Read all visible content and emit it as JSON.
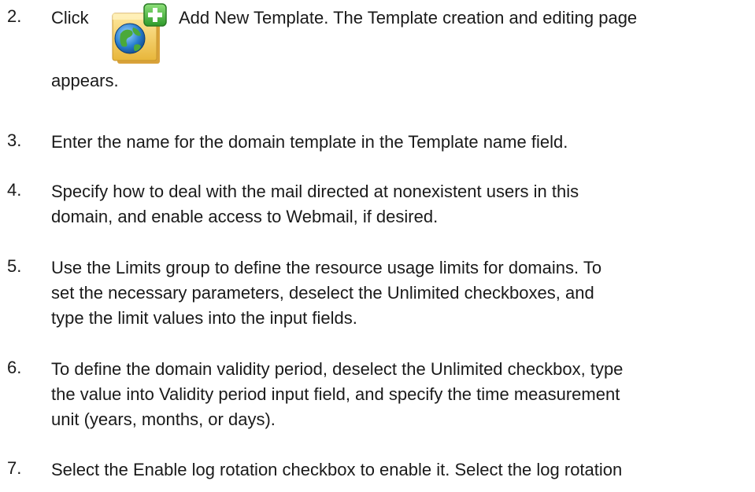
{
  "steps": [
    {
      "number": "2.",
      "lines": [
        "Click",
        "Add New Template. The Template creation and editing page",
        "appears."
      ]
    },
    {
      "number": "3.",
      "lines": [
        "Enter the name for the domain template in the Template name field."
      ]
    },
    {
      "number": "4.",
      "lines": [
        "Specify how to deal with the mail directed at nonexistent users in this",
        "domain, and enable access to Webmail, if desired."
      ]
    },
    {
      "number": "5.",
      "lines": [
        "Use the Limits group to define the resource usage limits for domains. To",
        "set the necessary parameters, deselect the Unlimited checkboxes, and",
        "type the limit values into the input fields."
      ]
    },
    {
      "number": "6.",
      "lines": [
        "To define the domain validity period, deselect the Unlimited checkbox, type",
        "the value into Validity period input field, and specify the time measurement",
        "unit (years, months, or days)."
      ]
    },
    {
      "number": "7.",
      "lines": [
        "Select the Enable log rotation checkbox to enable it. Select the log rotation"
      ]
    }
  ],
  "icons": {
    "add_template": "add-new-template-icon"
  }
}
